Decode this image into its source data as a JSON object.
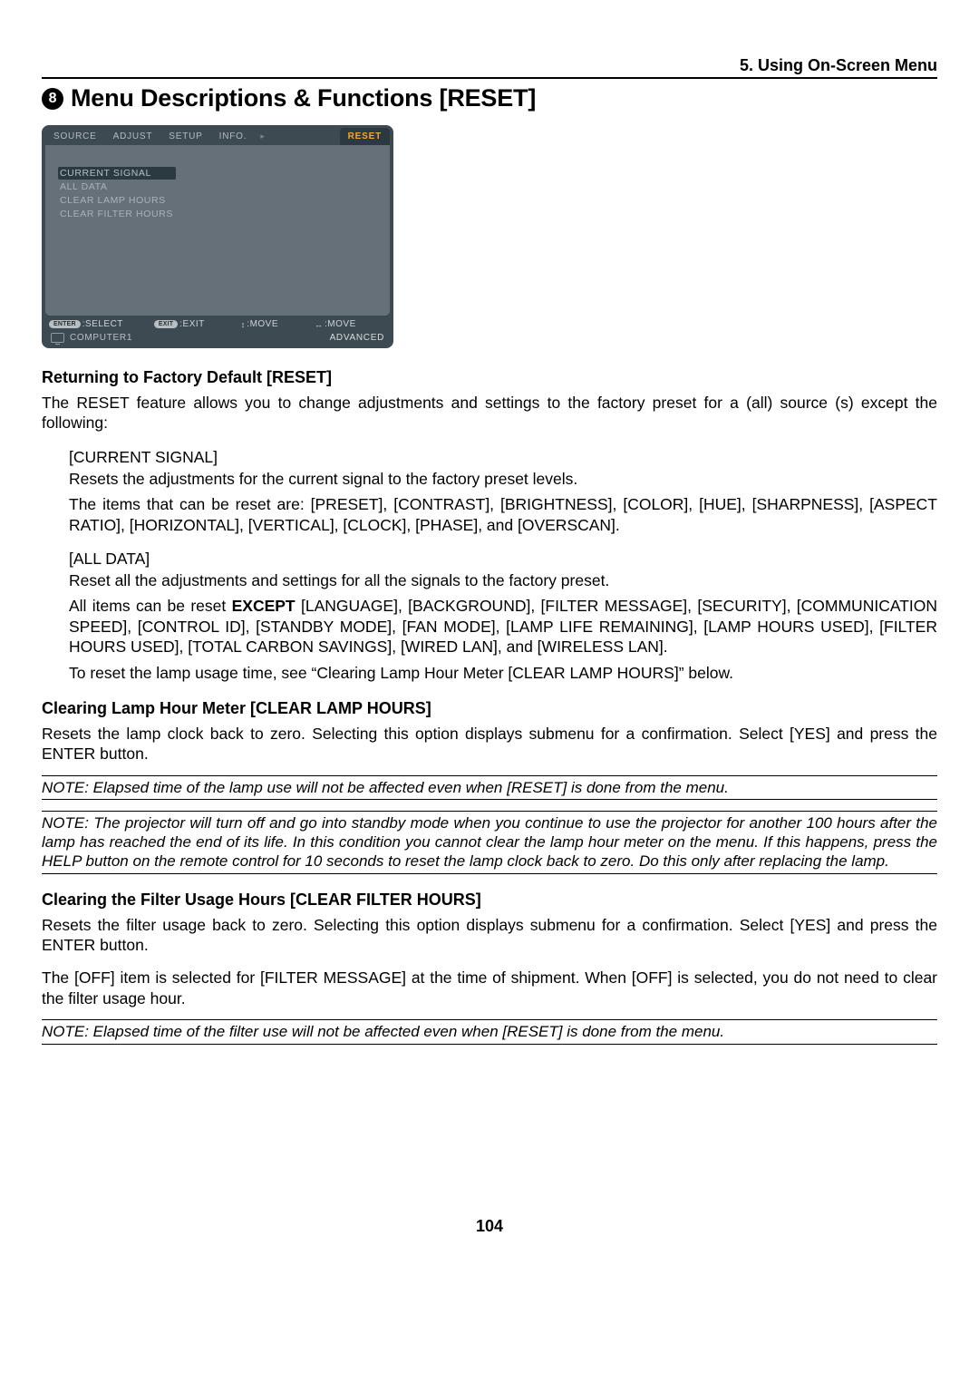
{
  "header": {
    "chapter": "5. Using On-Screen Menu"
  },
  "section": {
    "number": "8",
    "title": "Menu Descriptions & Functions [RESET]"
  },
  "osd": {
    "tabs": [
      "SOURCE",
      "ADJUST",
      "SETUP",
      "INFO."
    ],
    "active_tab": "RESET",
    "items": [
      "CURRENT SIGNAL",
      "ALL DATA",
      "CLEAR LAMP HOURS",
      "CLEAR FILTER HOURS"
    ],
    "hints": {
      "enter_pill": "ENTER",
      "enter_label": ":SELECT",
      "exit_pill": "EXIT",
      "exit_label": ":EXIT",
      "move_ud": ":MOVE",
      "move_lr": ":MOVE"
    },
    "footer": {
      "source": "COMPUTER1",
      "mode": "ADVANCED"
    }
  },
  "sections": {
    "s1_title": "Returning to Factory Default [RESET]",
    "s1_p1": "The RESET feature allows you to change adjustments and settings to the factory preset for a (all) source (s) except the following:",
    "s1_cs_label": "[CURRENT SIGNAL]",
    "s1_cs_p1": "Resets the adjustments for the current signal to the factory preset levels.",
    "s1_cs_p2": "The items that can be reset are: [PRESET], [CONTRAST], [BRIGHTNESS], [COLOR], [HUE], [SHARPNESS], [ASPECT RATIO], [HORIZONTAL], [VERTICAL], [CLOCK], [PHASE], and [OVERSCAN].",
    "s1_ad_label": "[ALL DATA]",
    "s1_ad_p1": "Reset all the adjustments and settings for all the signals to the factory preset.",
    "s1_ad_p2a": "All items can be reset ",
    "s1_ad_p2b": "EXCEPT",
    "s1_ad_p2c": " [LANGUAGE], [BACKGROUND], [FILTER MESSAGE], [SECURITY], [COMMUNICATION SPEED], [CONTROL ID], [STANDBY MODE], [FAN MODE], [LAMP LIFE REMAINING], [LAMP HOURS USED], [FILTER HOURS USED], [TOTAL CARBON SAVINGS], [WIRED LAN], and [WIRELESS LAN].",
    "s1_ad_p3": "To reset the lamp usage time, see “Clearing Lamp Hour Meter [CLEAR LAMP HOURS]” below.",
    "s2_title": "Clearing Lamp Hour Meter [CLEAR LAMP HOURS]",
    "s2_p1": "Resets the lamp clock back to zero. Selecting this option displays submenu for a confirmation. Select [YES] and press the ENTER button.",
    "s2_note1": "NOTE: Elapsed time of the lamp use will not be affected even when [RESET] is done from the menu.",
    "s2_note2": "NOTE: The projector will turn off and go into standby mode when you continue to use the projector for another 100 hours after the lamp has reached the end of its life. In this condition you cannot clear the lamp hour meter on the menu. If this happens, press the HELP button on the remote control for 10 seconds to reset the lamp clock back to zero. Do this only after replacing the lamp.",
    "s3_title": "Clearing the Filter Usage Hours [CLEAR FILTER HOURS]",
    "s3_p1": "Resets the filter usage back to zero. Selecting this option displays submenu for a confirmation. Select [YES] and press the ENTER button.",
    "s3_p2": "The [OFF] item is selected for [FILTER MESSAGE] at the time of shipment. When [OFF] is selected, you do not need to clear the filter usage hour.",
    "s3_note": "NOTE: Elapsed time of the filter use will not be affected even when [RESET] is done from the menu."
  },
  "page_number": "104"
}
